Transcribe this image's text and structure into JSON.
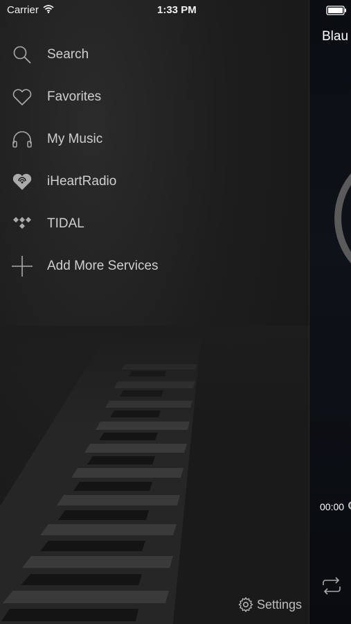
{
  "status": {
    "carrier": "Carrier",
    "time": "1:33 PM"
  },
  "menu": [
    {
      "label": "Search",
      "icon": "search-icon"
    },
    {
      "label": "Favorites",
      "icon": "heart-icon"
    },
    {
      "label": "My Music",
      "icon": "headphones-icon"
    },
    {
      "label": "iHeartRadio",
      "icon": "iheartradio-icon"
    },
    {
      "label": "TIDAL",
      "icon": "tidal-icon"
    },
    {
      "label": "Add More Services",
      "icon": "plus-icon"
    }
  ],
  "footer": {
    "settings_label": "Settings"
  },
  "player": {
    "title": "Blau",
    "time_elapsed": "00:00"
  }
}
